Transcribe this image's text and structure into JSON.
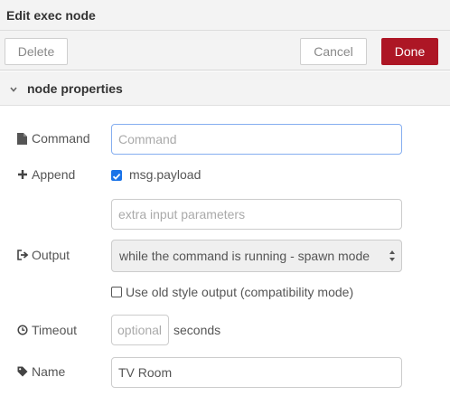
{
  "window": {
    "title": "Edit exec node"
  },
  "toolbar": {
    "delete_label": "Delete",
    "cancel_label": "Cancel",
    "done_label": "Done"
  },
  "section": {
    "title": "node properties",
    "icon": "chevron-down-icon"
  },
  "form": {
    "command": {
      "label": "Command",
      "icon": "file-icon",
      "value": "",
      "placeholder": "Command"
    },
    "append": {
      "label": "Append",
      "icon": "plus-icon",
      "checkbox_label": "msg.payload",
      "checked": true,
      "extra_placeholder": "extra input parameters"
    },
    "output": {
      "label": "Output",
      "icon": "sign-out-icon",
      "selected": "while the command is running - spawn mode",
      "old_style_label": "Use old style output (compatibility mode)",
      "old_style_checked": false
    },
    "timeout": {
      "label": "Timeout",
      "icon": "clock-icon",
      "placeholder": "optional",
      "unit": "seconds"
    },
    "name": {
      "label": "Name",
      "icon": "tag-icon",
      "value": "TV Room"
    }
  },
  "colors": {
    "accent": "#ad1625",
    "checkbox": "#1a73e8",
    "focus_border": "#85aef0"
  }
}
